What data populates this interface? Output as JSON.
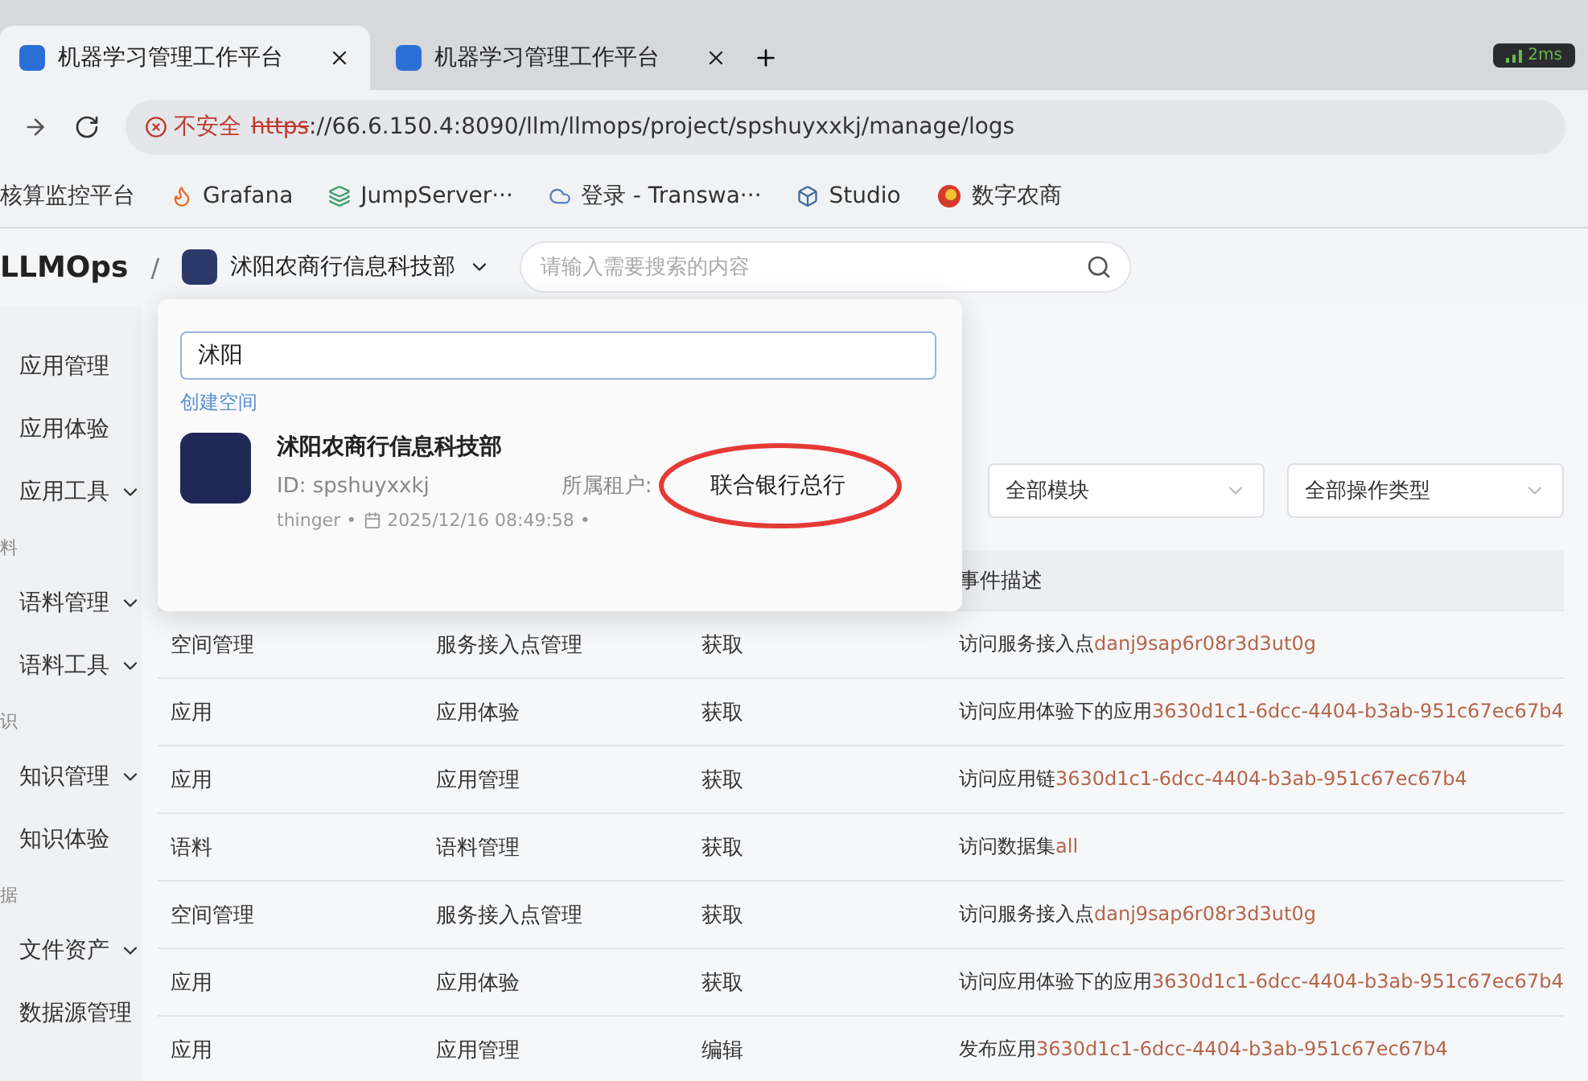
{
  "browser": {
    "tabs": [
      {
        "title": "机器学习管理工作平台",
        "selected": true
      },
      {
        "title": "机器学习管理工作平台",
        "selected": false
      }
    ],
    "latency": "2ms",
    "security": "不安全",
    "url_scheme": "https",
    "url_rest": "://66.6.150.4:8090/llm/llmops/project/spshuyxxkj/manage/logs",
    "bookmarks": [
      {
        "kind": "plain",
        "label": "核算监控平台"
      },
      {
        "kind": "grafana",
        "label": "Grafana"
      },
      {
        "kind": "jump",
        "label": "JumpServer···"
      },
      {
        "kind": "cloud",
        "label": "登录 - Transwa···"
      },
      {
        "kind": "studio",
        "label": "Studio"
      },
      {
        "kind": "bank",
        "label": "数字农商"
      }
    ]
  },
  "header": {
    "logo": "LLMOps",
    "separator": "/",
    "workspace": "沭阳农商行信息科技部",
    "search": {
      "placeholder": "请输入需要搜索的内容"
    }
  },
  "sidebar": {
    "items": [
      {
        "kind": "item",
        "label": "应用管理",
        "expandable": false
      },
      {
        "kind": "item",
        "label": "应用体验",
        "expandable": false
      },
      {
        "kind": "item",
        "label": "应用工具",
        "expandable": true
      },
      {
        "kind": "section",
        "label": "料"
      },
      {
        "kind": "item",
        "label": "语料管理",
        "expandable": true
      },
      {
        "kind": "item",
        "label": "语料工具",
        "expandable": true
      },
      {
        "kind": "section",
        "label": "识"
      },
      {
        "kind": "item",
        "label": "知识管理",
        "expandable": true
      },
      {
        "kind": "item",
        "label": "知识体验",
        "expandable": false
      },
      {
        "kind": "section",
        "label": "据"
      },
      {
        "kind": "item",
        "label": "文件资产",
        "expandable": true
      },
      {
        "kind": "item",
        "label": "数据源管理",
        "expandable": false
      }
    ]
  },
  "filters": [
    {
      "value": "全部模块"
    },
    {
      "value": "全部操作类型"
    }
  ],
  "table": {
    "columns": [
      "事件描述"
    ],
    "rows": [
      {
        "column_1": "空间管理",
        "column_2": "服务接入点管理",
        "column_3": "获取",
        "action": "访问服务接入点",
        "target": "danj9sap6r08r3d3ut0g"
      },
      {
        "column_1": "应用",
        "column_2": "应用体验",
        "column_3": "获取",
        "action": "访问应用体验下的应用",
        "target": "3630d1c1-6dcc-4404-b3ab-951c67ec67b4"
      },
      {
        "column_1": "应用",
        "column_2": "应用管理",
        "column_3": "获取",
        "action": "访问应用链",
        "target": "3630d1c1-6dcc-4404-b3ab-951c67ec67b4"
      },
      {
        "column_1": "语料",
        "column_2": "语料管理",
        "column_3": "获取",
        "action": "访问数据集",
        "target": "all"
      },
      {
        "column_1": "空间管理",
        "column_2": "服务接入点管理",
        "column_3": "获取",
        "action": "访问服务接入点",
        "target": "danj9sap6r08r3d3ut0g"
      },
      {
        "column_1": "应用",
        "column_2": "应用体验",
        "column_3": "获取",
        "action": "访问应用体验下的应用",
        "target": "3630d1c1-6dcc-4404-b3ab-951c67ec67b4"
      },
      {
        "column_1": "应用",
        "column_2": "应用管理",
        "column_3": "编辑",
        "action": "发布应用",
        "target": "3630d1c1-6dcc-4404-b3ab-951c67ec67b4"
      }
    ]
  },
  "popover": {
    "search_value": "沭阳",
    "create_link": "创建空间",
    "workspace": {
      "name": "沭阳农商行信息科技部",
      "id_label": "ID:",
      "id": "spshuyxxkj",
      "tenant_label": "所属租户:",
      "tenant": "联合银行总行",
      "owner": "thinger",
      "created": "2025/12/16 08:49:58",
      "meta_separator": "•"
    }
  }
}
